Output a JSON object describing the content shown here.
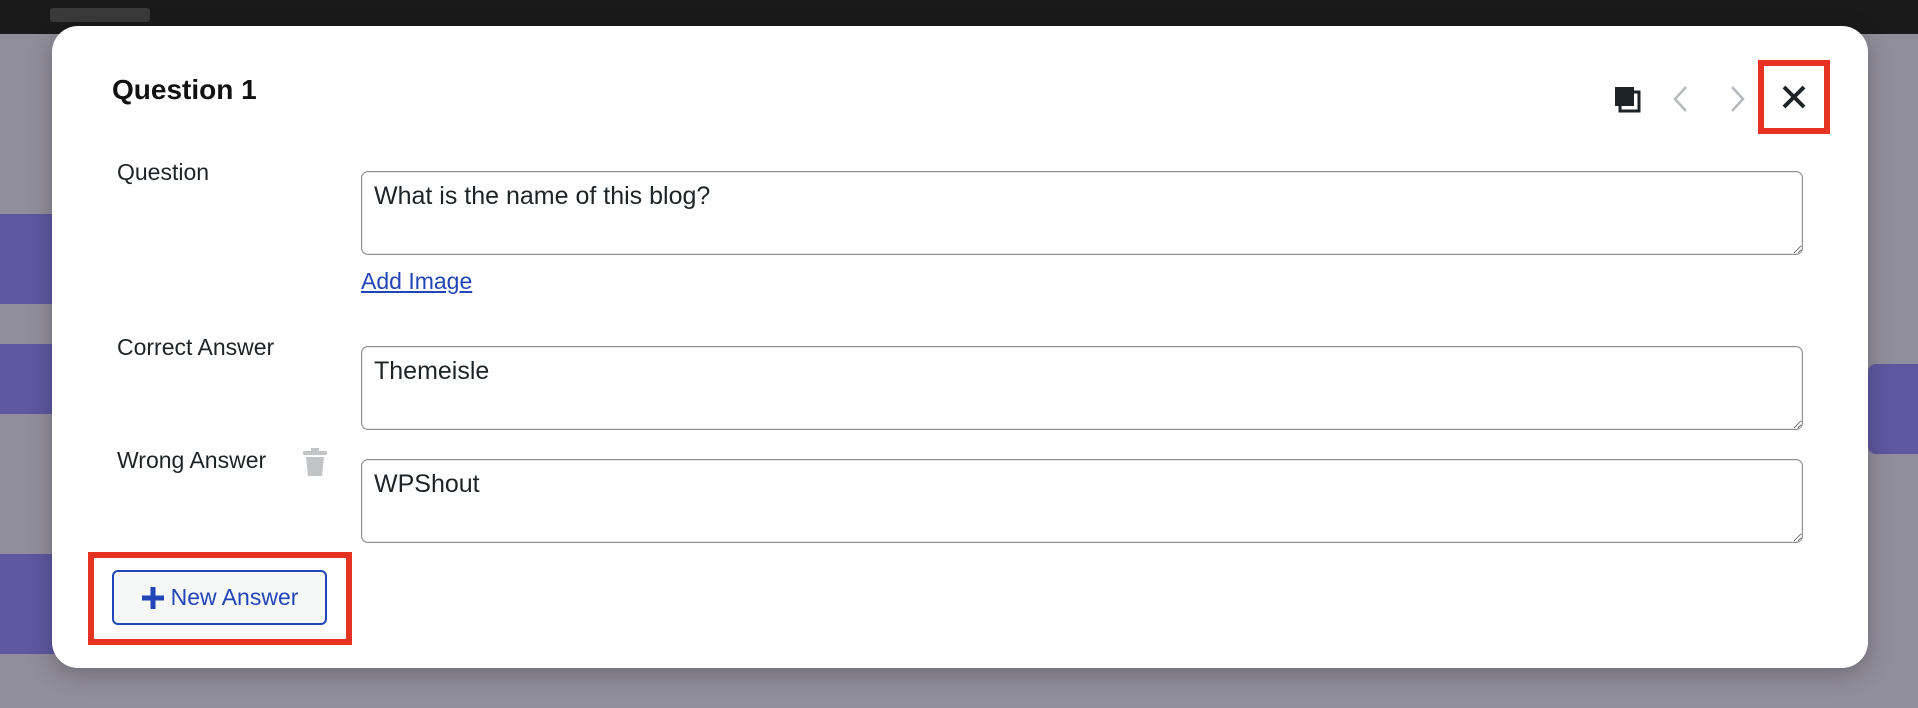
{
  "modal": {
    "title": "Question 1",
    "fields": {
      "question": {
        "label": "Question",
        "value": "What is the name of this blog?"
      },
      "add_image": "Add Image",
      "correct_answer": {
        "label": "Correct Answer",
        "value": "Themeisle"
      },
      "wrong_answer": {
        "label": "Wrong Answer",
        "value": "WPShout"
      }
    },
    "new_answer_label": "New Answer",
    "header_icons": [
      "duplicate-icon",
      "chevron-left-icon",
      "chevron-right-icon",
      "close-icon"
    ],
    "highlight_color": "#e63323",
    "accent_color": "#2245b7"
  }
}
